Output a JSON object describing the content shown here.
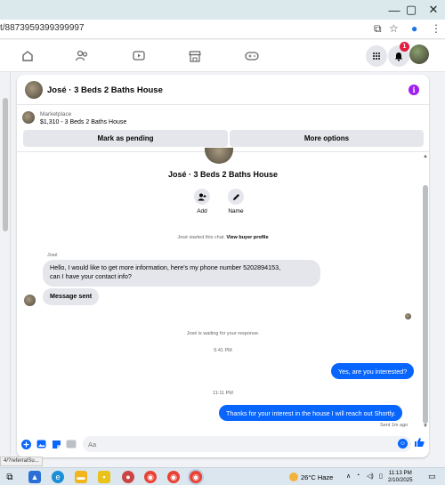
{
  "browser": {
    "window_controls": {
      "minimize": "—",
      "maximize": "▢",
      "close": "✕"
    },
    "url": "t/8873959399399997",
    "status_url": "4/?referralSu..."
  },
  "nav": {
    "notifications_badge": "1"
  },
  "chat_header": {
    "title": "José · 3 Beds 2 Baths House",
    "info_icon": "i"
  },
  "marketplace": {
    "label": "Marketplace",
    "listing": "$1,310 - 3 Beds 2 Baths House",
    "mark_pending": "Mark as pending",
    "more_options": "More options"
  },
  "chat": {
    "title": "José · 3 Beds 2 Baths House",
    "add_label": "Add",
    "name_label": "Name",
    "started_text": "José started this chat.",
    "view_profile": "View buyer profile",
    "sender_name": "José",
    "msg1_line1": "Hello,  I would like to get more information, here's my phone number 5202894153,",
    "msg1_line2": "can I have your contact info?",
    "msg2": "Message sent",
    "waiting": "José is waiting for your response.",
    "time1": "5:41 PM",
    "out1": "Yes, are you interested?",
    "time2": "11:11 PM",
    "out2": "Thanks for your interest in the house I will reach out Shortly.",
    "sent_status": "Sent 1m ago"
  },
  "composer": {
    "placeholder": "Aa"
  },
  "taskbar": {
    "temperature": "26°C  Haze",
    "time": "11:13 PM",
    "date": "2/10/2025"
  }
}
